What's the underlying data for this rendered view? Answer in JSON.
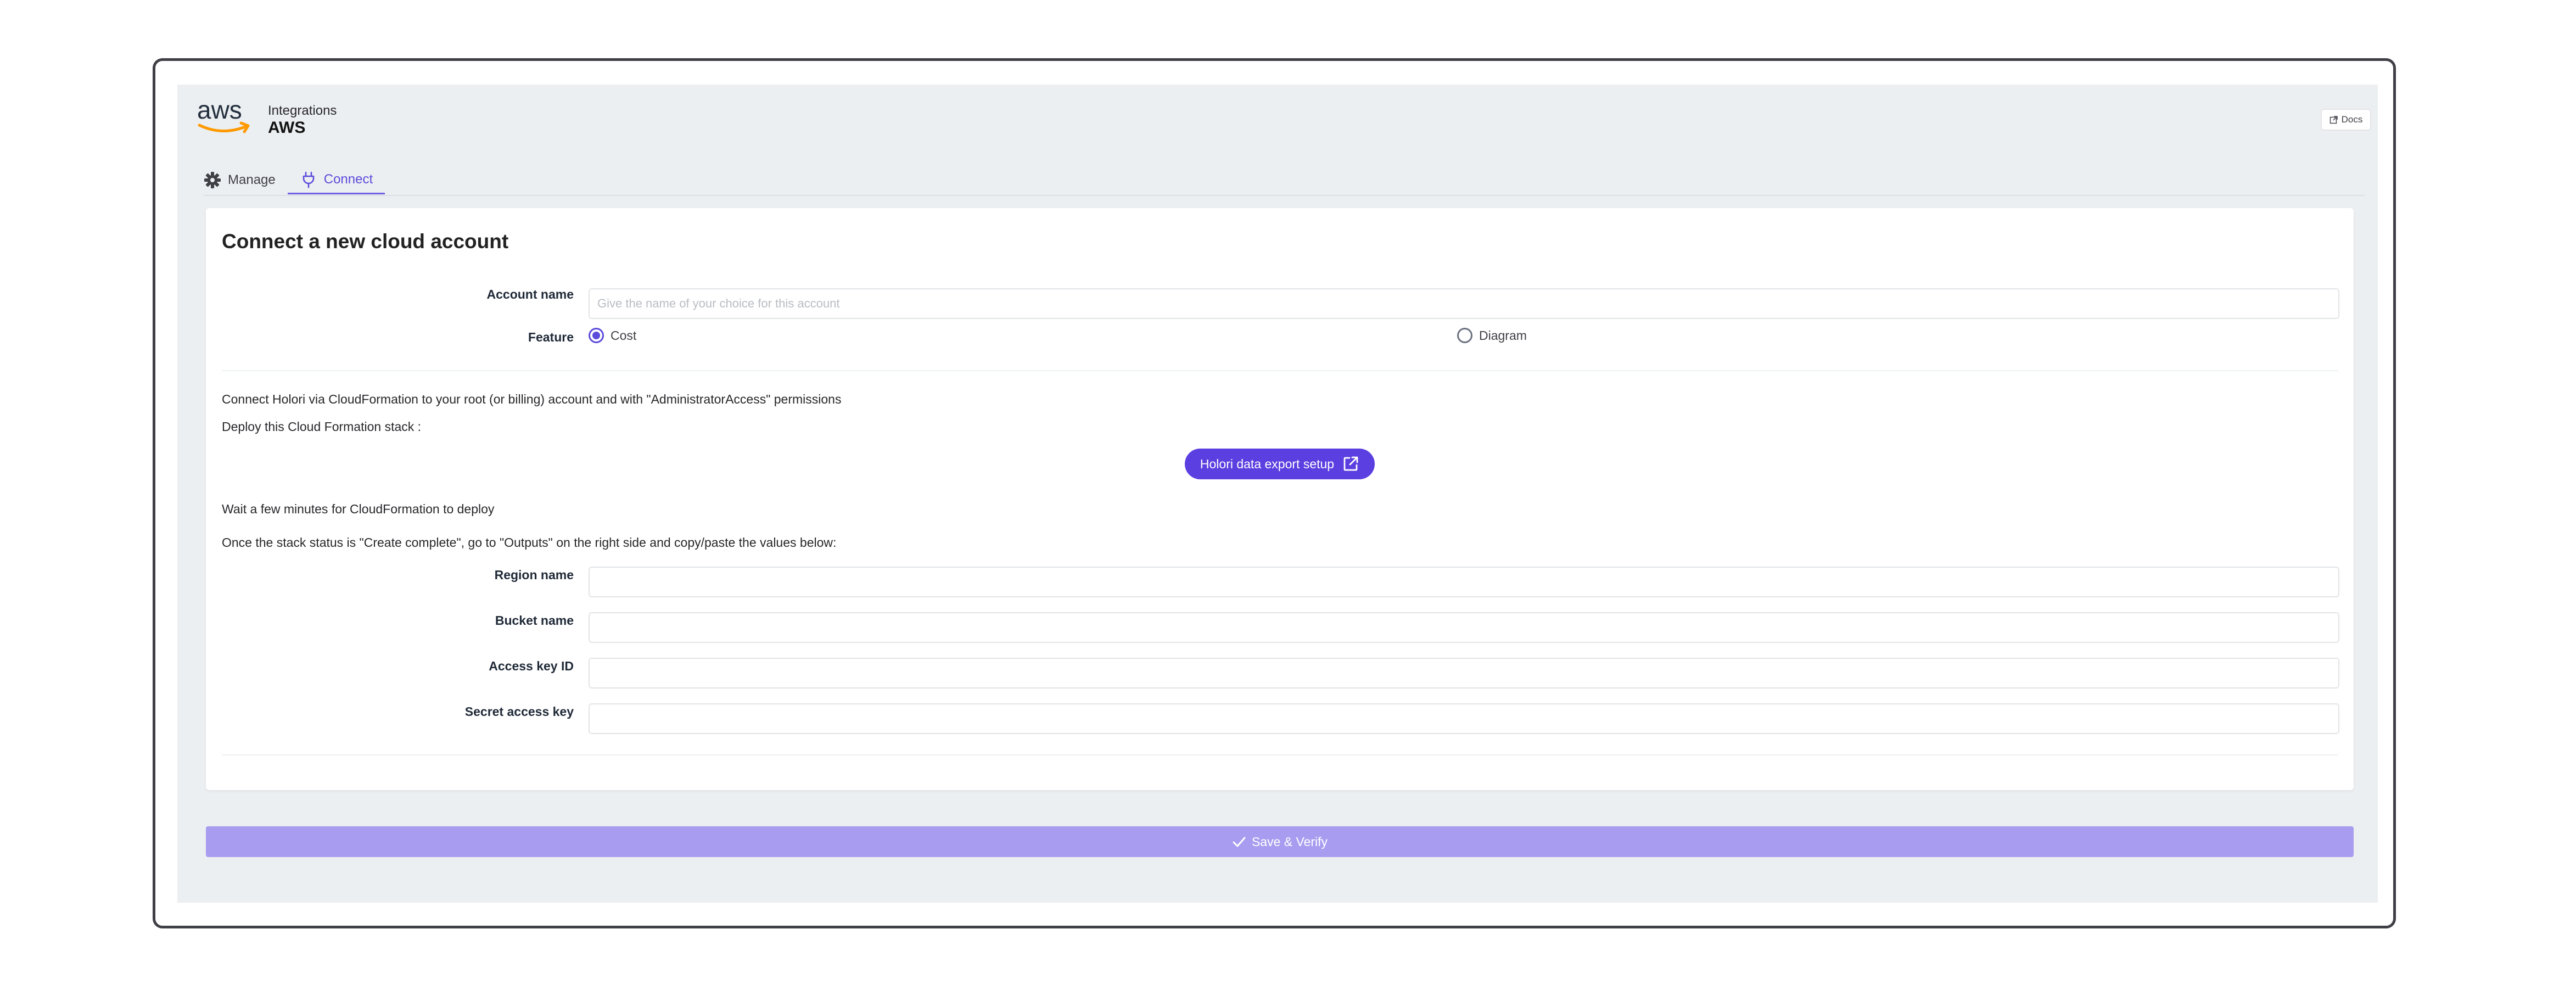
{
  "header": {
    "logo_text": "aws",
    "breadcrumb": "Integrations",
    "title": "AWS",
    "docs_label": "Docs"
  },
  "tabs": [
    {
      "label": "Manage",
      "icon": "gear-icon",
      "active": false
    },
    {
      "label": "Connect",
      "icon": "plug-icon",
      "active": true
    }
  ],
  "form": {
    "title": "Connect a new cloud account",
    "account_name": {
      "label": "Account name",
      "value": "",
      "placeholder": "Give the name of your choice for this account"
    },
    "feature": {
      "label": "Feature",
      "options": [
        {
          "label": "Cost",
          "checked": true
        },
        {
          "label": "Diagram",
          "checked": false
        }
      ]
    },
    "instructions": {
      "line1": "Connect Holori via CloudFormation to your root (or billing) account and with \"AdministratorAccess\" permissions",
      "line2": "Deploy this Cloud Formation stack :",
      "export_button": "Holori data export setup",
      "line3": "Wait a few minutes for CloudFormation to deploy",
      "line4": "Once the stack status is \"Create complete\", go to \"Outputs\" on the right side and copy/paste the values below:"
    },
    "outputs": [
      {
        "label": "Region name",
        "value": ""
      },
      {
        "label": "Bucket name",
        "value": ""
      },
      {
        "label": "Access key ID",
        "value": ""
      },
      {
        "label": "Secret access key",
        "value": ""
      }
    ],
    "save_label": "Save & Verify"
  },
  "colors": {
    "accent": "#5b3fe0",
    "accent_disabled": "#a89cf0",
    "aws_orange": "#ff9900",
    "background": "#eceff1"
  }
}
